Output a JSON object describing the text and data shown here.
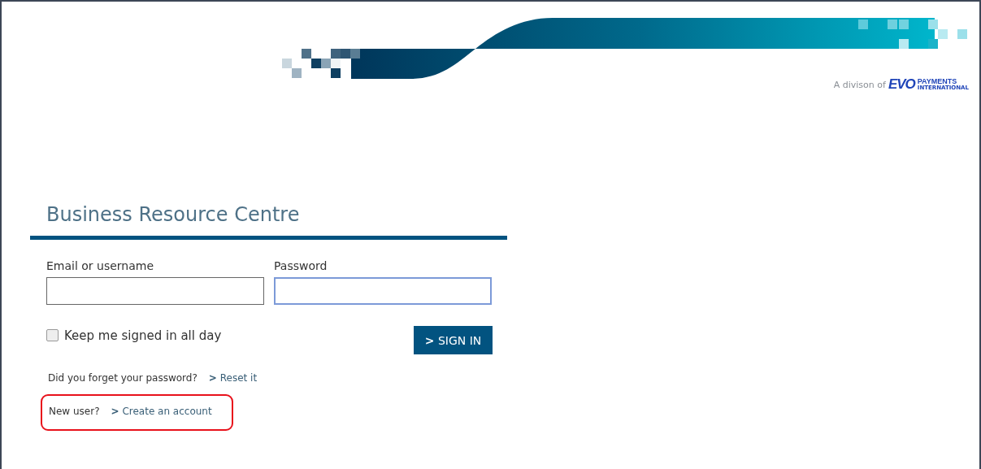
{
  "header": {
    "division_text": "A divison of",
    "logo_mark": "EVO",
    "logo_line_1": "PAYMENTS",
    "logo_line_2": "INTERNATIONAL"
  },
  "login": {
    "title": "Business Resource Centre",
    "fields": [
      {
        "label": "Email or username",
        "focused": false
      },
      {
        "label": "Password",
        "focused": true
      }
    ],
    "remember": {
      "label": "Keep me signed in all day",
      "checked": false
    },
    "submit": {
      "arrow": ">",
      "label": "SIGN IN"
    },
    "links": [
      {
        "question": "Did you forget your password?",
        "arrow": ">",
        "link": "Reset it",
        "highlighted": false
      },
      {
        "question": "New user?",
        "arrow": ">",
        "link": "Create an account",
        "highlighted": true
      }
    ]
  }
}
